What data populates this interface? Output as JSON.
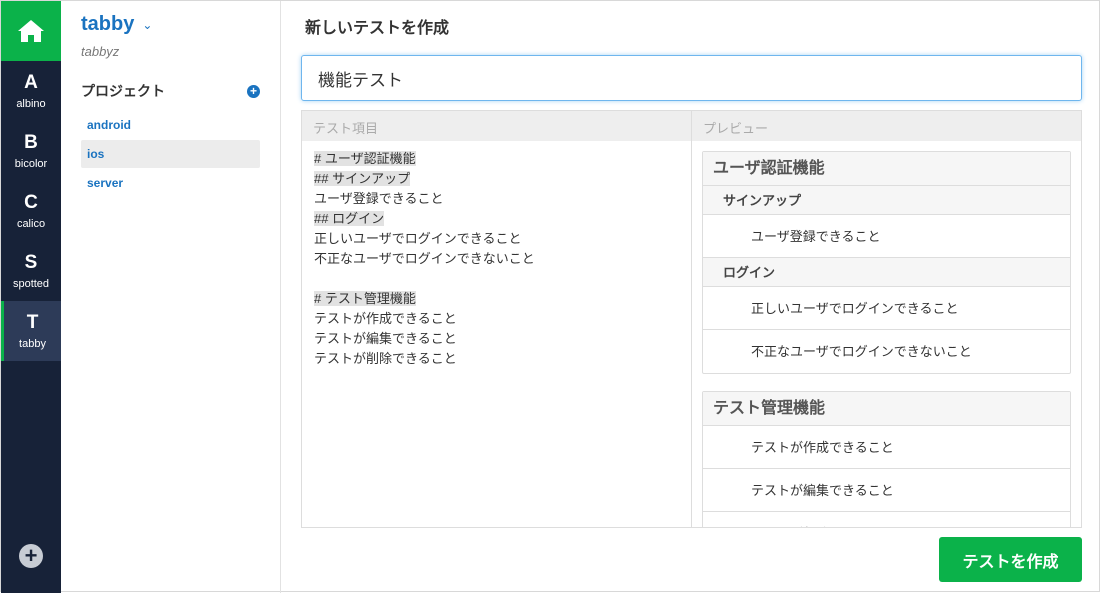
{
  "rail": {
    "teams": [
      {
        "letter": "A",
        "name": "albino"
      },
      {
        "letter": "B",
        "name": "bicolor"
      },
      {
        "letter": "C",
        "name": "calico"
      },
      {
        "letter": "S",
        "name": "spotted"
      },
      {
        "letter": "T",
        "name": "tabby"
      }
    ],
    "add": "+"
  },
  "sidebar": {
    "team": "tabby",
    "chevron": "⌄",
    "subtitle": "tabbyz",
    "projects_label": "プロジェクト",
    "add": "+",
    "projects": [
      "android",
      "ios",
      "server"
    ]
  },
  "main": {
    "title": "新しいテストを作成",
    "name_value": "機能テスト",
    "editor_label": "テスト項目",
    "preview_label": "プレビュー",
    "source": [
      "# ユーザ認証機能",
      "## サインアップ",
      "ユーザ登録できること",
      "## ログイン",
      "正しいユーザでログインできること",
      "不正なユーザでログインできないこと",
      "",
      "# テスト管理機能",
      "テストが作成できること",
      "テストが編集できること",
      "テストが削除できること"
    ],
    "preview": [
      {
        "title": "ユーザ認証機能",
        "sections": [
          {
            "title": "サインアップ",
            "items": [
              "ユーザ登録できること"
            ]
          },
          {
            "title": "ログイン",
            "items": [
              "正しいユーザでログインできること",
              "不正なユーザでログインできないこと"
            ]
          }
        ]
      },
      {
        "title": "テスト管理機能",
        "sections": [
          {
            "title": "",
            "items": [
              "テストが作成できること",
              "テストが編集できること",
              "テストが削除できること"
            ]
          }
        ]
      }
    ],
    "create_label": "テストを作成"
  }
}
